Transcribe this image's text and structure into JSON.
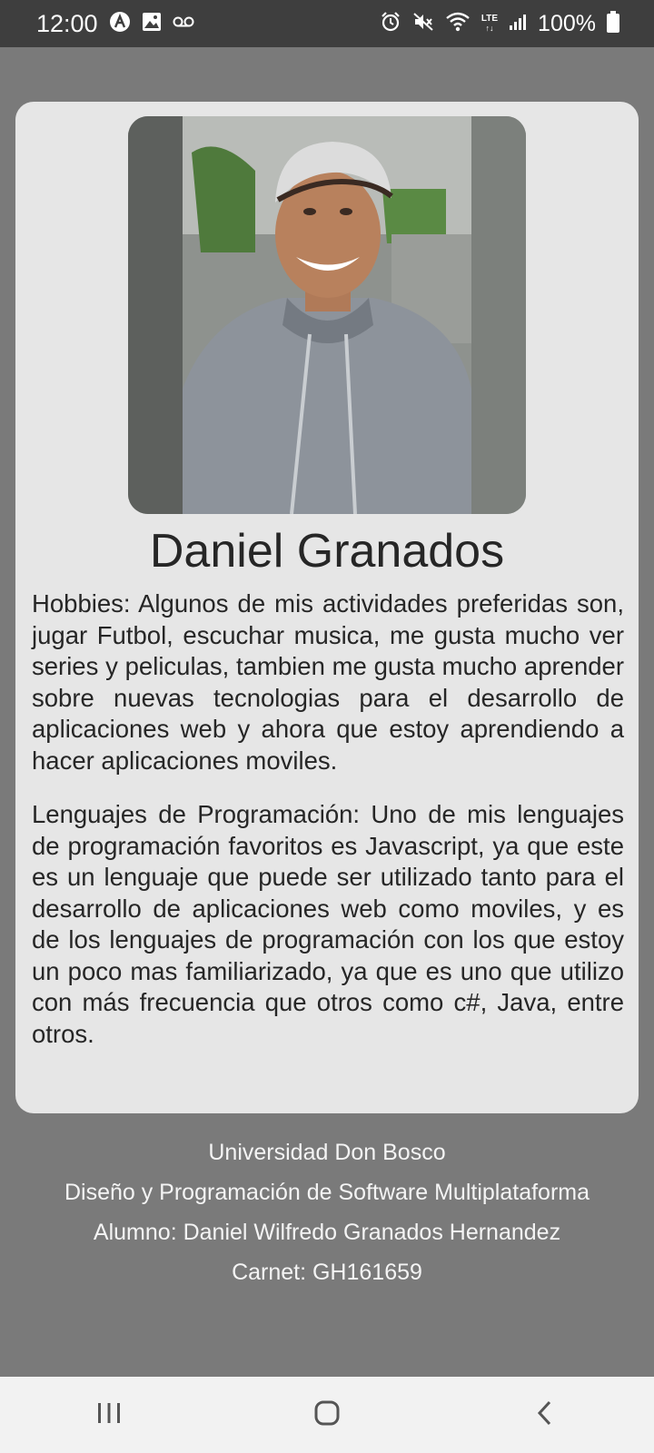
{
  "status_bar": {
    "time": "12:00",
    "battery_text": "100%",
    "network_label": "LTE",
    "left_icons": [
      "app-a-icon",
      "image-icon",
      "voicemail-icon"
    ],
    "right_icons": [
      "alarm-icon",
      "mute-icon",
      "wifi-icon",
      "lte-icon",
      "signal-icon",
      "battery-icon"
    ]
  },
  "profile": {
    "photo_icon": "profile-photo",
    "name": "Daniel Granados",
    "hobbies": "Hobbies:  Algunos de mis actividades preferidas son, jugar Futbol, escuchar musica, me gusta mucho ver series y peliculas, tambien me gusta mucho aprender sobre nuevas tecnologias para el desarrollo de aplicaciones web y ahora que estoy aprendiendo a hacer aplicaciones moviles.",
    "languages": "Lenguajes de Programación:  Uno de mis lenguajes de programación favoritos es Javascript, ya que este es un lenguaje que puede ser utilizado tanto para el desarrollo de aplicaciones web como moviles, y es de los lenguajes de programación con los que estoy un poco mas familiarizado, ya que es uno que utilizo con más frecuencia que otros como c#, Java, entre otros."
  },
  "footer": {
    "university": "Universidad Don Bosco",
    "course": "Diseño y Programación de Software Multiplataforma",
    "student": "Alumno: Daniel Wilfredo Granados Hernandez",
    "carnet": "Carnet: GH161659"
  },
  "nav_bar": {
    "icons": [
      "recent-apps-icon",
      "home-icon",
      "back-icon"
    ]
  },
  "colors": {
    "background": "#7a7a7a",
    "card": "#e6e6e6",
    "status_bar": "#3e3e3e",
    "text": "#262626",
    "footer_text": "#f4f4f4",
    "nav_bar": "#f2f2f2"
  }
}
